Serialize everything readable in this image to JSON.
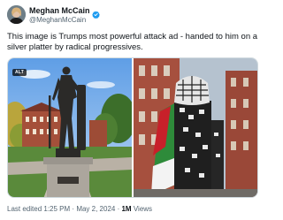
{
  "author": {
    "display_name": "Meghan McCain",
    "handle": "@MeghanMcCain",
    "verified": true
  },
  "tweet": {
    "text": "This image is Trumps most powerful attack ad - handed to him on a silver platter by radical progressives."
  },
  "media": {
    "left_badge": "ALT"
  },
  "meta": {
    "edited_prefix": "Last edited",
    "time": "1:25 PM",
    "separator": "·",
    "date": "May 2, 2024",
    "views_count": "1M",
    "views_label": "Views"
  },
  "colors": {
    "verified": "#1d9bf0",
    "secondary_text": "#536471",
    "primary_text": "#0f1419"
  }
}
